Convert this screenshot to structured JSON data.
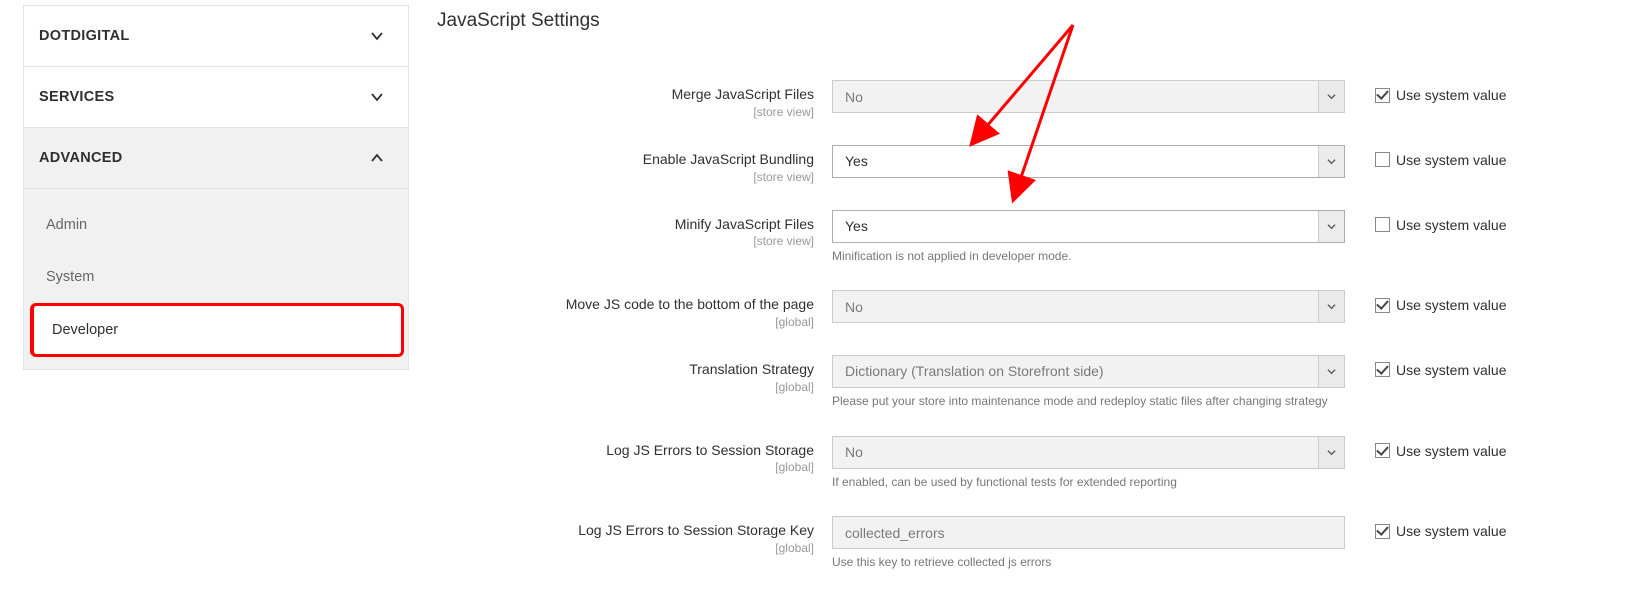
{
  "sidebar": {
    "sections": [
      {
        "label": "DOTDIGITAL",
        "expanded": false
      },
      {
        "label": "SERVICES",
        "expanded": false
      },
      {
        "label": "ADVANCED",
        "expanded": true
      }
    ],
    "advanced_items": [
      {
        "label": "Admin",
        "active": false
      },
      {
        "label": "System",
        "active": false
      },
      {
        "label": "Developer",
        "active": true
      }
    ]
  },
  "section_title": "JavaScript Settings",
  "use_system_value_label": "Use system value",
  "settings": {
    "merge_js": {
      "label": "Merge JavaScript Files",
      "scope": "[store view]",
      "value": "No",
      "disabled": true,
      "use_system": true
    },
    "bundling": {
      "label": "Enable JavaScript Bundling",
      "scope": "[store view]",
      "value": "Yes",
      "disabled": false,
      "use_system": false
    },
    "minify": {
      "label": "Minify JavaScript Files",
      "scope": "[store view]",
      "value": "Yes",
      "disabled": false,
      "use_system": false,
      "note": "Minification is not applied in developer mode."
    },
    "move_js": {
      "label": "Move JS code to the bottom of the page",
      "scope": "[global]",
      "value": "No",
      "disabled": true,
      "use_system": true
    },
    "translation": {
      "label": "Translation Strategy",
      "scope": "[global]",
      "value": "Dictionary (Translation on Storefront side)",
      "disabled": true,
      "use_system": true,
      "note": "Please put your store into maintenance mode and redeploy static files after changing strategy"
    },
    "log_js": {
      "label": "Log JS Errors to Session Storage",
      "scope": "[global]",
      "value": "No",
      "disabled": true,
      "use_system": true,
      "note": "If enabled, can be used by functional tests for extended reporting"
    },
    "log_js_key": {
      "label": "Log JS Errors to Session Storage Key",
      "scope": "[global]",
      "value": "collected_errors",
      "disabled": true,
      "use_system": true,
      "note": "Use this key to retrieve collected js errors"
    }
  }
}
